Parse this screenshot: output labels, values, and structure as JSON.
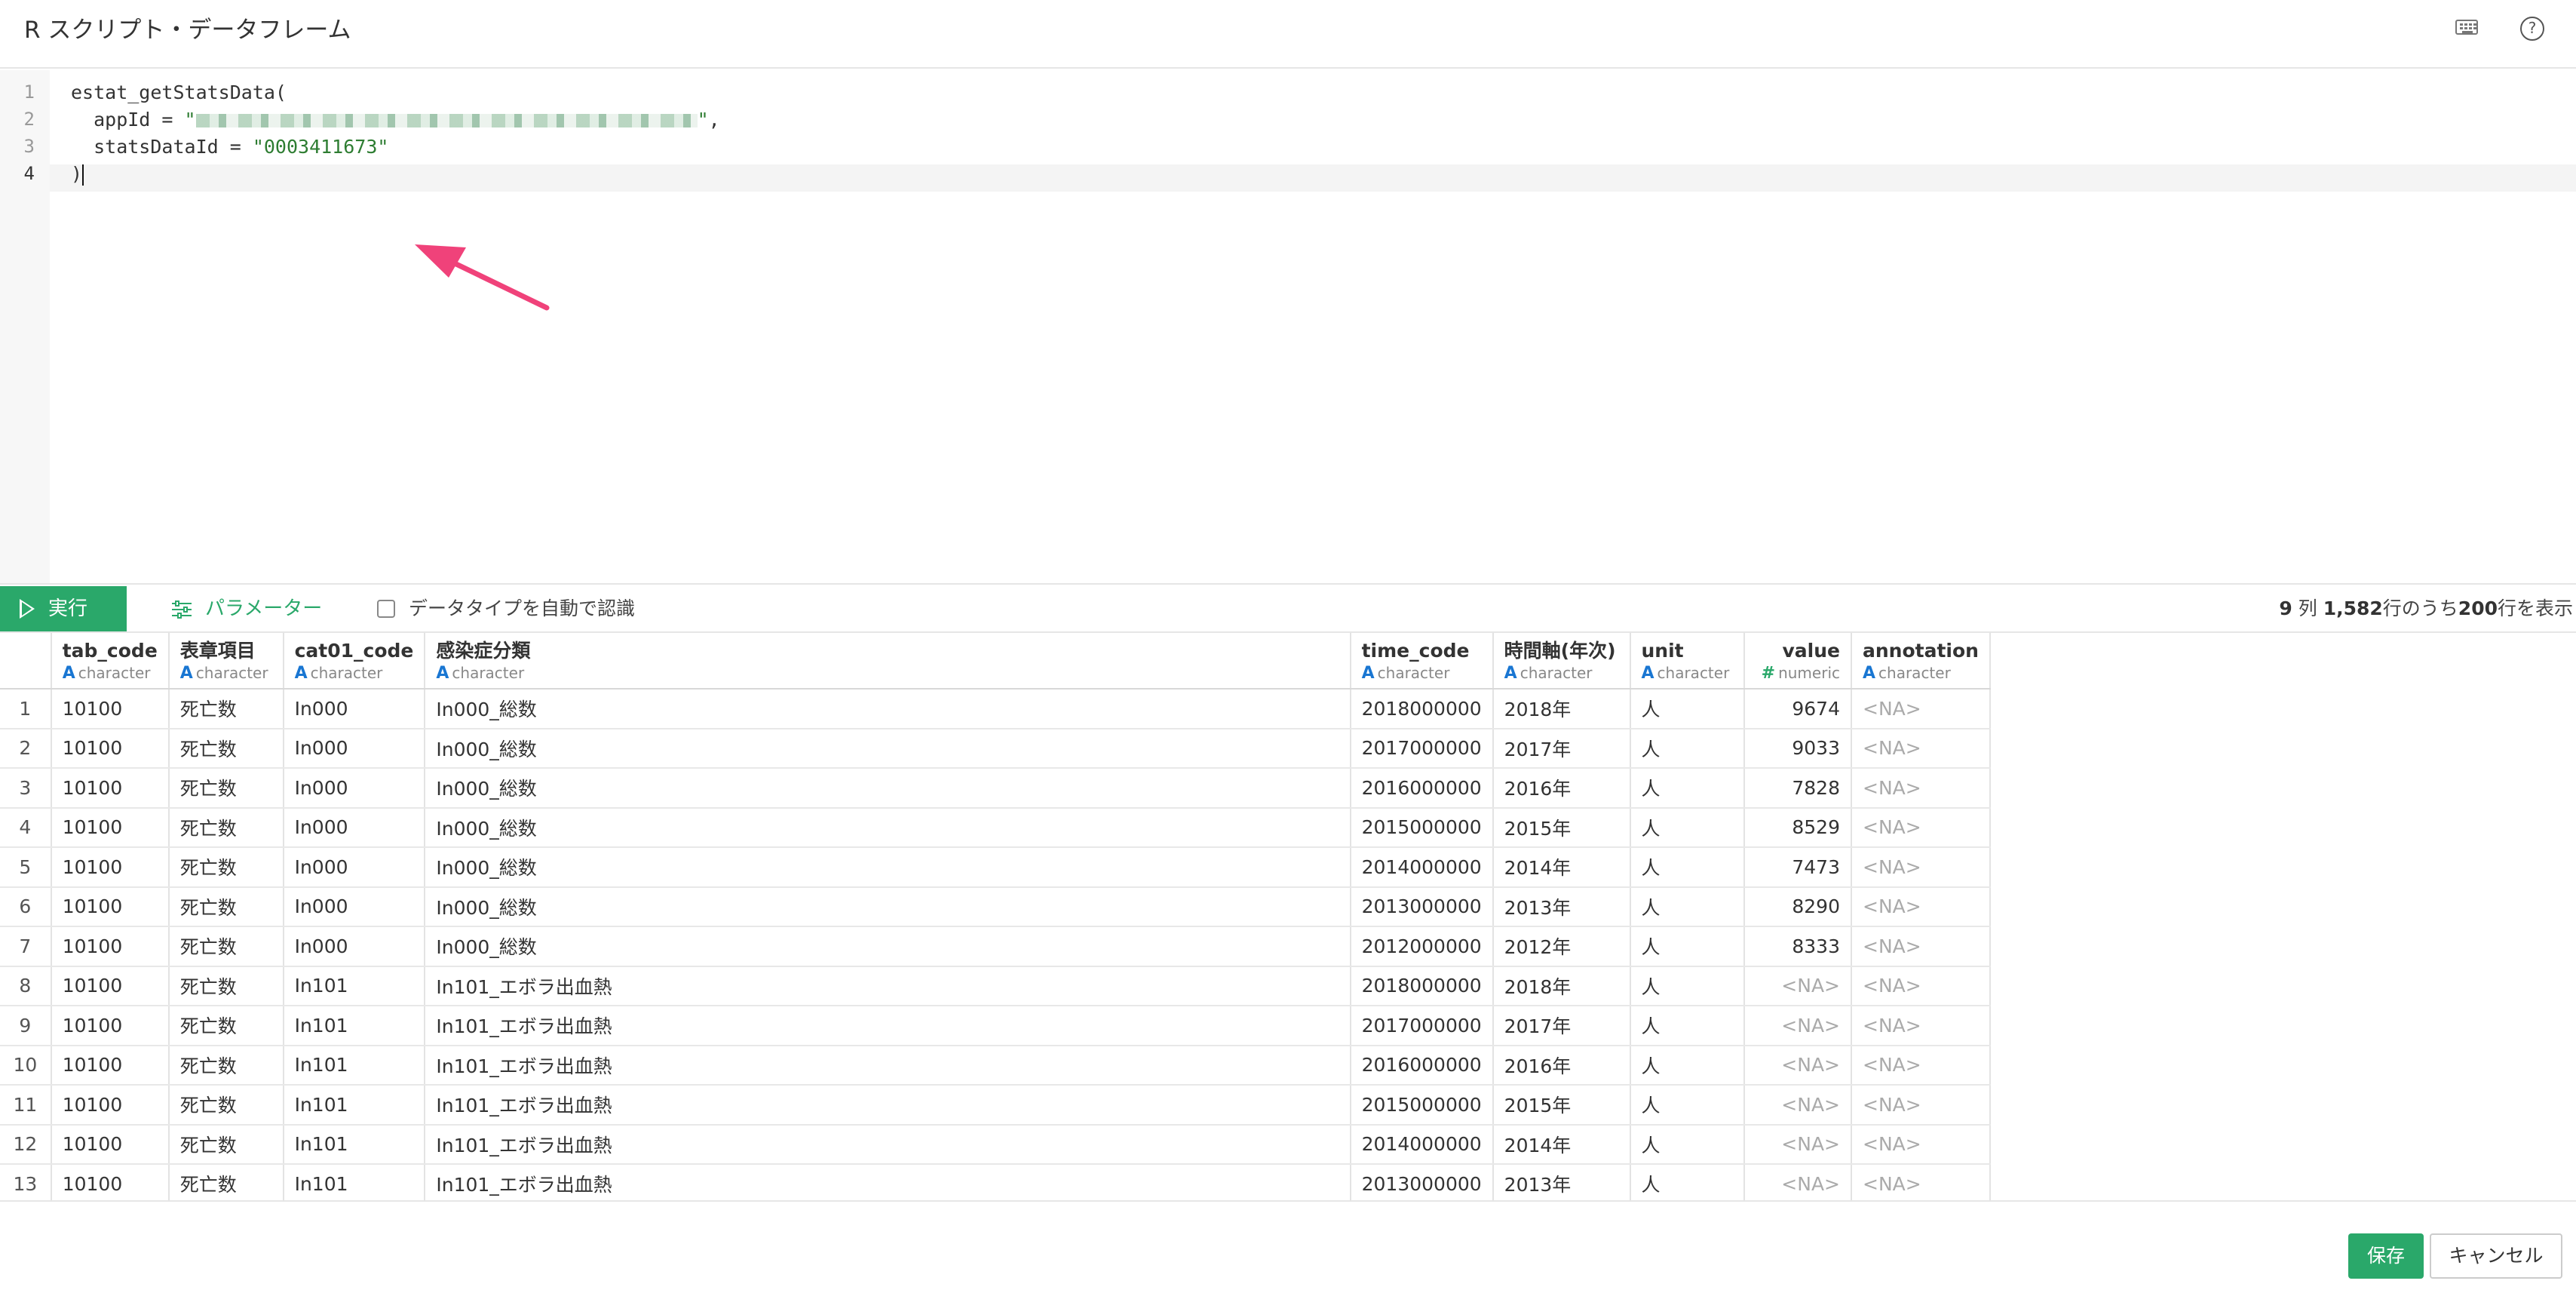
{
  "window": {
    "title": "R スクリプト・データフレーム"
  },
  "header_icons": [
    "keyboard-icon",
    "help-icon"
  ],
  "editor": {
    "line_numbers": [
      "1",
      "2",
      "3",
      "4"
    ],
    "lines": {
      "l1": "estat_getStatsData(",
      "l2_prefix": "  appId = ",
      "l2_quote_open": "\"",
      "l2_quote_close": "\"",
      "l2_suffix": ",",
      "l3_prefix": "  statsDataId = ",
      "l3_value": "\"0003411673\"",
      "l4": ")"
    }
  },
  "toolbar": {
    "run_label": "実行",
    "params_label": "パラメーター",
    "auto_type_label": "データタイプを自動で認識",
    "summary_cols": "9",
    "summary_cols_unit": " 列 ",
    "summary_rows": "1,582",
    "summary_mid": "行のうち",
    "summary_shown": "200",
    "summary_tail": "行を表示"
  },
  "table": {
    "columns": [
      {
        "name": "tab_code",
        "type": "character",
        "icon": "A"
      },
      {
        "name": "表章項目",
        "type": "character",
        "icon": "A"
      },
      {
        "name": "cat01_code",
        "type": "character",
        "icon": "A"
      },
      {
        "name": "感染症分類",
        "type": "character",
        "icon": "A"
      },
      {
        "name": "time_code",
        "type": "character",
        "icon": "A"
      },
      {
        "name": "時間軸(年次)",
        "type": "character",
        "icon": "A"
      },
      {
        "name": "unit",
        "type": "character",
        "icon": "A"
      },
      {
        "name": "value",
        "type": "numeric",
        "icon": "#"
      },
      {
        "name": "annotation",
        "type": "character",
        "icon": "A"
      }
    ],
    "rows": [
      [
        "1",
        "10100",
        "死亡数",
        "In000",
        "In000_総数",
        "2018000000",
        "2018年",
        "人",
        "9674",
        "<NA>"
      ],
      [
        "2",
        "10100",
        "死亡数",
        "In000",
        "In000_総数",
        "2017000000",
        "2017年",
        "人",
        "9033",
        "<NA>"
      ],
      [
        "3",
        "10100",
        "死亡数",
        "In000",
        "In000_総数",
        "2016000000",
        "2016年",
        "人",
        "7828",
        "<NA>"
      ],
      [
        "4",
        "10100",
        "死亡数",
        "In000",
        "In000_総数",
        "2015000000",
        "2015年",
        "人",
        "8529",
        "<NA>"
      ],
      [
        "5",
        "10100",
        "死亡数",
        "In000",
        "In000_総数",
        "2014000000",
        "2014年",
        "人",
        "7473",
        "<NA>"
      ],
      [
        "6",
        "10100",
        "死亡数",
        "In000",
        "In000_総数",
        "2013000000",
        "2013年",
        "人",
        "8290",
        "<NA>"
      ],
      [
        "7",
        "10100",
        "死亡数",
        "In000",
        "In000_総数",
        "2012000000",
        "2012年",
        "人",
        "8333",
        "<NA>"
      ],
      [
        "8",
        "10100",
        "死亡数",
        "In101",
        "In101_エボラ出血熱",
        "2018000000",
        "2018年",
        "人",
        "<NA>",
        "<NA>"
      ],
      [
        "9",
        "10100",
        "死亡数",
        "In101",
        "In101_エボラ出血熱",
        "2017000000",
        "2017年",
        "人",
        "<NA>",
        "<NA>"
      ],
      [
        "10",
        "10100",
        "死亡数",
        "In101",
        "In101_エボラ出血熱",
        "2016000000",
        "2016年",
        "人",
        "<NA>",
        "<NA>"
      ],
      [
        "11",
        "10100",
        "死亡数",
        "In101",
        "In101_エボラ出血熱",
        "2015000000",
        "2015年",
        "人",
        "<NA>",
        "<NA>"
      ],
      [
        "12",
        "10100",
        "死亡数",
        "In101",
        "In101_エボラ出血熱",
        "2014000000",
        "2014年",
        "人",
        "<NA>",
        "<NA>"
      ],
      [
        "13",
        "10100",
        "死亡数",
        "In101",
        "In101_エボラ出血熱",
        "2013000000",
        "2013年",
        "人",
        "<NA>",
        "<NA>"
      ]
    ]
  },
  "footer": {
    "save_label": "保存",
    "cancel_label": "キャンセル"
  },
  "colors": {
    "accent": "#2aa86a",
    "string": "#2e7d32",
    "type_icon": "#1976d2",
    "arrow": "#f0427a"
  }
}
